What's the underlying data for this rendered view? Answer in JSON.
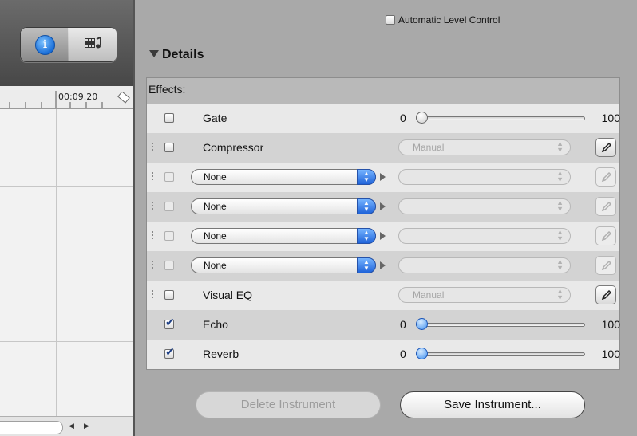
{
  "timeline": {
    "timecode": "00:09.20",
    "toolbar": {
      "info_icon": "info-icon",
      "media_icon": "media-browser-icon"
    },
    "scroll_left": "◀",
    "scroll_right": "▶"
  },
  "alc": {
    "label": "Automatic Level Control",
    "checked": false
  },
  "details": {
    "title": "Details"
  },
  "effects": {
    "label": "Effects:",
    "rows": [
      {
        "kind": "slider",
        "label": "Gate",
        "checked": false,
        "min": "0",
        "max": "100",
        "value": 0
      },
      {
        "kind": "preset",
        "label": "Compressor",
        "checked": false,
        "preset": "Manual"
      },
      {
        "kind": "slot",
        "selection": "None"
      },
      {
        "kind": "slot",
        "selection": "None"
      },
      {
        "kind": "slot",
        "selection": "None"
      },
      {
        "kind": "slot",
        "selection": "None"
      },
      {
        "kind": "preset",
        "label": "Visual EQ",
        "checked": false,
        "preset": "Manual"
      },
      {
        "kind": "slider",
        "label": "Echo",
        "checked": true,
        "min": "0",
        "max": "100",
        "value": 0
      },
      {
        "kind": "slider",
        "label": "Reverb",
        "checked": true,
        "min": "0",
        "max": "100",
        "value": 0
      }
    ]
  },
  "buttons": {
    "delete": "Delete Instrument",
    "save": "Save Instrument..."
  }
}
